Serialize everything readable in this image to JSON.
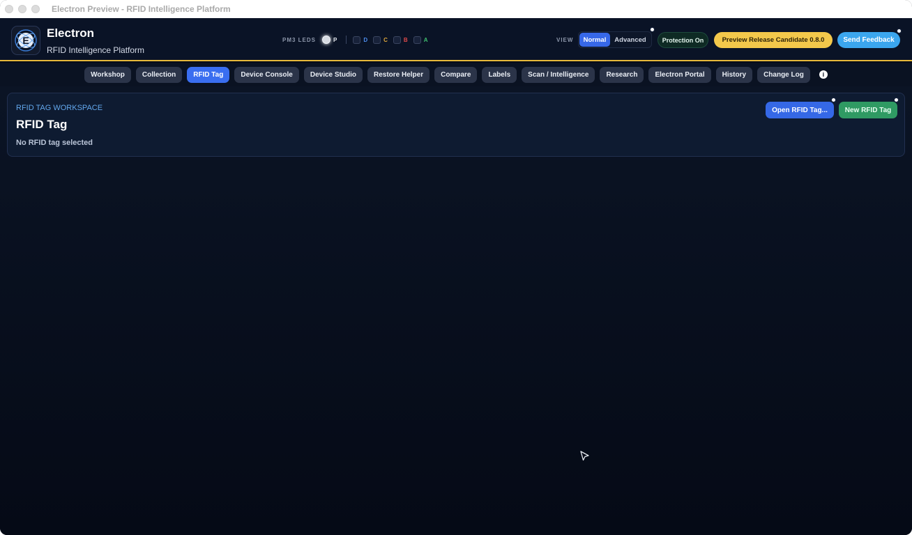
{
  "window": {
    "title": "Electron Preview - RFID Intelligence Platform"
  },
  "header": {
    "brand_name": "Electron",
    "brand_subtitle": "RFID Intelligence Platform",
    "leds": {
      "label": "PM3 LEDS",
      "items": [
        {
          "letter": "P",
          "color": "#e8ecf2"
        },
        {
          "letter": "D",
          "color": "#4d8ef0"
        },
        {
          "letter": "C",
          "color": "#e0a73a"
        },
        {
          "letter": "B",
          "color": "#e04a4a"
        },
        {
          "letter": "A",
          "color": "#3fbf6f"
        }
      ]
    },
    "view_label": "VIEW",
    "view_normal": "Normal",
    "view_advanced": "Advanced",
    "protection": "Protection On",
    "release_candidate": "Preview Release Candidate 0.8.0",
    "feedback": "Send Feedback"
  },
  "nav": {
    "tabs": [
      {
        "label": "Workshop"
      },
      {
        "label": "Collection"
      },
      {
        "label": "RFID Tag",
        "active": true
      },
      {
        "label": "Device Console"
      },
      {
        "label": "Device Studio"
      },
      {
        "label": "Restore Helper"
      },
      {
        "label": "Compare"
      },
      {
        "label": "Labels"
      },
      {
        "label": "Scan / Intelligence"
      },
      {
        "label": "Research"
      },
      {
        "label": "Electron Portal"
      },
      {
        "label": "History"
      },
      {
        "label": "Change Log"
      }
    ],
    "info_icon": "info-icon"
  },
  "workspace": {
    "kicker": "RFID TAG WORKSPACE",
    "title": "RFID Tag",
    "subtitle": "No RFID tag selected",
    "open_button": "Open RFID Tag...",
    "new_button": "New RFID Tag"
  },
  "colors": {
    "accent_blue": "#3a6ef0",
    "accent_gold": "#e7b93a",
    "feedback_blue": "#3ba6ee",
    "success_green": "#2f9a63"
  }
}
